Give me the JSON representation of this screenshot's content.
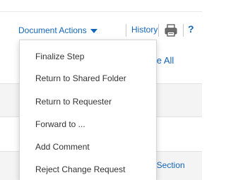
{
  "toolbar": {
    "document_actions_label": "Document Actions",
    "history_label": "History",
    "help_label": "?",
    "print_icon": "printer-icon",
    "caret_icon": "caret-down-icon"
  },
  "page": {
    "collapse_all_label": "pse All",
    "section_link_label": "t Section"
  },
  "menu": {
    "items": [
      {
        "label": "Finalize Step"
      },
      {
        "label": "Return to Shared Folder"
      },
      {
        "label": "Return to Requester"
      },
      {
        "label": "Forward to ..."
      },
      {
        "label": "Add Comment"
      },
      {
        "label": "Reject Change Request"
      }
    ]
  },
  "colors": {
    "link": "#1565b6",
    "menu_text": "#333333",
    "band": "#f4f4f4"
  }
}
